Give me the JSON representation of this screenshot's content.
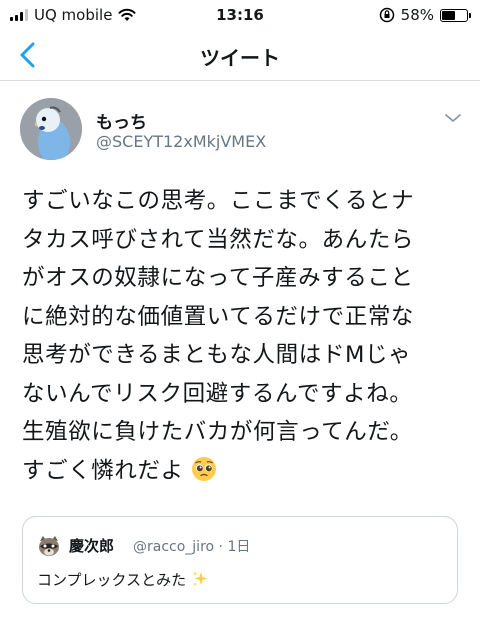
{
  "status_bar": {
    "carrier": "UQ mobile",
    "time": "13:16",
    "battery_percent": "58%",
    "battery_level": 0.58
  },
  "nav": {
    "title": "ツイート"
  },
  "tweet": {
    "name": "もっち",
    "handle": "@SCEYT12xMkjVMEX",
    "lines": [
      "すごいなこの思考。ここまでくるとナ",
      "タカス呼びされて当然だな。あんたら",
      "がオスの奴隷になって子産みすること",
      "に絶対的な価値置いてるだけで正常な",
      "思考ができるまともな人間はドMじゃ",
      "ないんでリスク回避するんですよね。",
      "生殖欲に負けたバカが何言ってんだ。",
      "すごく憐れだよ"
    ],
    "emoji": "pleading-face-emoji"
  },
  "quote": {
    "name": "慶次郎",
    "handle_time": "@racco_jiro · 1日",
    "text": "コンプレックスとみた",
    "emoji": "sparkles-emoji"
  }
}
